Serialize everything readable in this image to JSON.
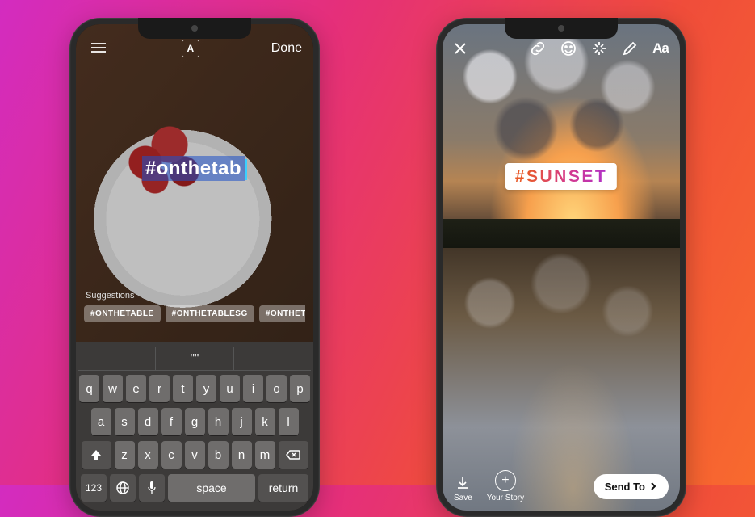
{
  "left": {
    "topbar": {
      "align_glyph": "A",
      "done": "Done"
    },
    "hashtag_input": "#onthetab",
    "suggestions": {
      "label": "Suggestions",
      "items": [
        "#ONTHETABLE",
        "#ONTHETABLESG",
        "#ONTHETAB",
        "#"
      ]
    },
    "keyboard": {
      "candidate_bar": [
        "",
        "\"\"",
        ""
      ],
      "row1": [
        "q",
        "w",
        "e",
        "r",
        "t",
        "y",
        "u",
        "i",
        "o",
        "p"
      ],
      "row2": [
        "a",
        "s",
        "d",
        "f",
        "g",
        "h",
        "j",
        "k",
        "l"
      ],
      "row3": [
        "z",
        "x",
        "c",
        "v",
        "b",
        "n",
        "m"
      ],
      "numkey": "123",
      "space": "space",
      "return": "return"
    }
  },
  "right": {
    "topbar": {
      "text_tool": "Aa"
    },
    "sticker": {
      "hash": "#",
      "word": "SUNSET"
    },
    "bottom": {
      "save": "Save",
      "your_story": "Your Story",
      "send_to": "Send To"
    }
  }
}
